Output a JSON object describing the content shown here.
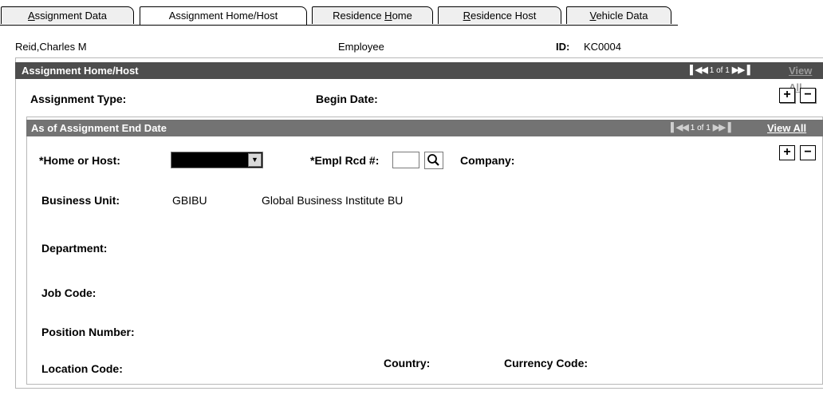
{
  "tabs": [
    {
      "label": "Assignment Data",
      "accesskey": "A"
    },
    {
      "label": "Assignment Home/Host",
      "active": true
    },
    {
      "label": "Residence Home",
      "accesskey": "H"
    },
    {
      "label": "Residence Host",
      "accesskey": "R"
    },
    {
      "label": "Vehicle Data",
      "accesskey": "V"
    }
  ],
  "header": {
    "name": "Reid,Charles M",
    "role": "Employee",
    "id_label": "ID:",
    "id_value": "KC0004"
  },
  "outer_scroll": {
    "title": "Assignment Home/Host",
    "nav_text": "1 of 1",
    "view_all": "View All",
    "assignment_type_label": "Assignment Type:",
    "begin_date_label": "Begin Date:",
    "add": "+",
    "remove": "−"
  },
  "inner_scroll": {
    "title": "As of Assignment End Date",
    "nav_text": "1 of 1",
    "view_all": "View All",
    "add": "+",
    "remove": "−",
    "home_or_host_label": "*Home or Host:",
    "home_or_host_value": "",
    "empl_rcd_label": "*Empl Rcd #:",
    "empl_rcd_value": "",
    "company_label": "Company:",
    "business_unit_label": "Business Unit:",
    "business_unit_code": "GBIBU",
    "business_unit_desc": "Global Business Institute BU",
    "department_label": "Department:",
    "job_code_label": "Job Code:",
    "position_number_label": "Position Number:",
    "location_code_label": "Location Code:",
    "country_label": "Country:",
    "currency_code_label": "Currency Code:"
  },
  "colors": {
    "outer_bar": "#4d4d4d",
    "inner_bar": "#737373",
    "tab_inactive": "#efefef"
  }
}
